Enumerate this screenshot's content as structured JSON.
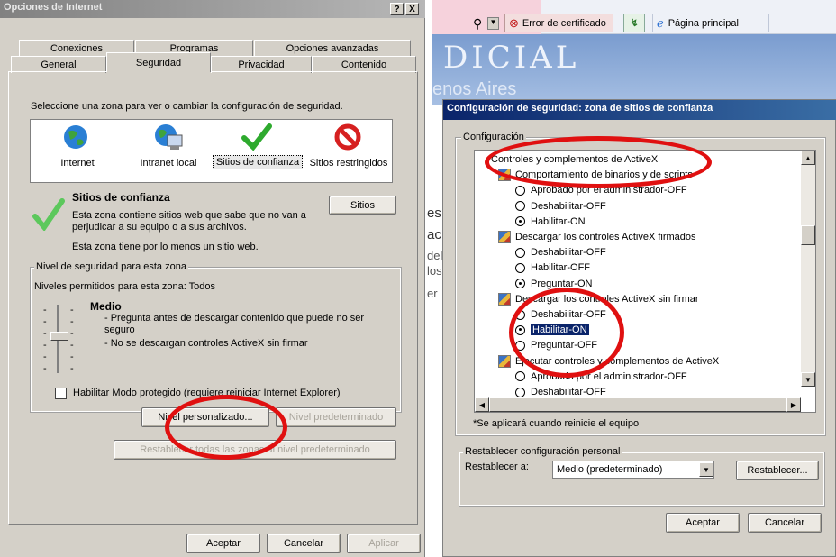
{
  "left": {
    "title": "Opciones de Internet",
    "help_btn": "?",
    "close_btn": "X",
    "tabs_row1": [
      "Conexiones",
      "Programas",
      "Opciones avanzadas"
    ],
    "tabs_row2": [
      "General",
      "Seguridad",
      "Privacidad",
      "Contenido"
    ],
    "instruction": "Seleccione una zona para ver o cambiar la configuración de seguridad.",
    "zones": [
      "Internet",
      "Intranet local",
      "Sitios de confianza",
      "Sitios restringidos"
    ],
    "zone_title": "Sitios de confianza",
    "zone_desc": "Esta zona contiene sitios web que sabe que no van a perjudicar a su equipo o a sus archivos.",
    "zone_note": "Esta zona tiene por lo menos un sitio web.",
    "sites_btn": "Sitios",
    "security_group": "Nivel de seguridad para esta zona",
    "allowed_levels": "Niveles permitidos para esta zona: Todos",
    "level_name": "Medio",
    "level_line1": "- Pregunta antes de descargar contenido que puede no ser",
    "level_line1b": "seguro",
    "level_line2": "- No se descargan controles ActiveX sin firmar",
    "protected_mode": "Habilitar Modo protegido (requiere reiniciar Internet Explorer)",
    "custom_btn": "Nivel personalizado...",
    "default_btn": "Nivel predeterminado",
    "reset_all_btn": "Restablecer todas las zonas al nivel predeterminado",
    "ok_btn": "Aceptar",
    "cancel_btn": "Cancelar",
    "apply_btn": "Aplicar"
  },
  "ie": {
    "cert_error": "Error de certificado",
    "home": "Página principal",
    "banner1": "DICIAL",
    "banner2": "enos Aires",
    "side_text": [
      "es",
      "ac",
      "del",
      "los",
      "er"
    ]
  },
  "right": {
    "title": "Configuración de seguridad: zona de sitios de confianza",
    "group": "Configuración",
    "items": [
      {
        "kind": "header",
        "text": "Controles y complementos de ActiveX"
      },
      {
        "kind": "section",
        "text": "Comportamiento de binarios y de scripts"
      },
      {
        "kind": "radio",
        "text": "Aprobado por el administrador-OFF",
        "on": false
      },
      {
        "kind": "radio",
        "text": "Deshabilitar-OFF",
        "on": false
      },
      {
        "kind": "radio",
        "text": "Habilitar-ON",
        "on": true
      },
      {
        "kind": "section",
        "text": "Descargar los controles ActiveX firmados"
      },
      {
        "kind": "radio",
        "text": "Deshabilitar-OFF",
        "on": false
      },
      {
        "kind": "radio",
        "text": "Habilitar-OFF",
        "on": false
      },
      {
        "kind": "radio",
        "text": "Preguntar-ON",
        "on": true
      },
      {
        "kind": "section",
        "text": "Descargar los controles ActiveX sin firmar"
      },
      {
        "kind": "radio",
        "text": "Deshabilitar-OFF",
        "on": false
      },
      {
        "kind": "radio",
        "text": "Habilitar-ON",
        "on": true,
        "selected": true
      },
      {
        "kind": "radio",
        "text": "Preguntar-OFF",
        "on": false
      },
      {
        "kind": "section",
        "text": "Ejecutar controles y complementos de ActiveX"
      },
      {
        "kind": "radio",
        "text": "Aprobado por el administrador-OFF",
        "on": false
      },
      {
        "kind": "radio",
        "text": "Deshabilitar-OFF",
        "on": false
      }
    ],
    "restart_note": "*Se aplicará cuando reinicie el equipo",
    "reset_group": "Restablecer configuración personal",
    "reset_label": "Restablecer a:",
    "reset_value": "Medio (predeterminado)",
    "reset_btn": "Restablecer...",
    "ok_btn": "Aceptar",
    "cancel_btn": "Cancelar"
  }
}
